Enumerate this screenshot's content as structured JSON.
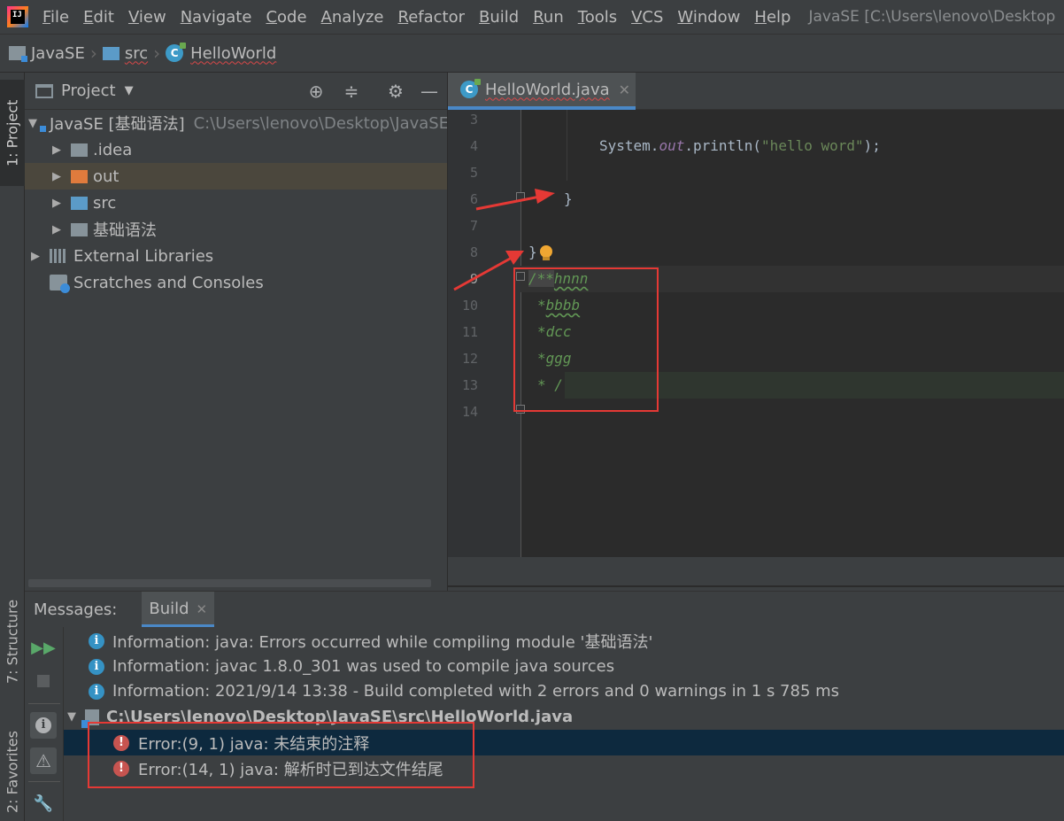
{
  "app": {
    "logo_text": "IJ",
    "window_title": "JavaSE [C:\\Users\\lenovo\\Desktop"
  },
  "menu": [
    "File",
    "Edit",
    "View",
    "Navigate",
    "Code",
    "Analyze",
    "Refactor",
    "Build",
    "Run",
    "Tools",
    "VCS",
    "Window",
    "Help"
  ],
  "breadcrumb": {
    "project": "JavaSE",
    "folder": "src",
    "file": "HelloWorld"
  },
  "left_strip": {
    "project_tab": "1: Project",
    "structure_tab": "7: Structure",
    "favorites_tab": "2: Favorites"
  },
  "project_panel": {
    "title": "Project",
    "tree": [
      {
        "label": "JavaSE [基础语法]",
        "path": "C:\\Users\\lenovo\\Desktop\\JavaSE",
        "expanded": true
      },
      {
        "label": ".idea"
      },
      {
        "label": "out",
        "selected": true
      },
      {
        "label": "src"
      },
      {
        "label": "基础语法"
      },
      {
        "label": "External Libraries"
      },
      {
        "label": "Scratches and Consoles"
      }
    ]
  },
  "editor": {
    "tab_label": "HelloWorld.java",
    "line_numbers": [
      "3",
      "4",
      "5",
      "6",
      "7",
      "8",
      "9",
      "10",
      "11",
      "12",
      "13",
      "14"
    ],
    "lines": {
      "l4_a": "System.",
      "l4_b": "out",
      "l4_c": ".println(",
      "l4_d": "\"hello word\"",
      "l4_e": ");",
      "l6": "}",
      "l8": "}",
      "l9_a": "/**",
      "l9_b": "hnnn",
      "l10_a": "*",
      "l10_b": "bbbb",
      "l11": "*dcc",
      "l12": "*ggg",
      "l13": "* /"
    }
  },
  "build": {
    "messages_label": "Messages:",
    "tab_label": "Build",
    "info": [
      "Information: java: Errors occurred while compiling module '基础语法'",
      "Information: javac 1.8.0_301 was used to compile java sources",
      "Information: 2021/9/14 13:38 - Build completed with 2 errors and 0 warnings in 1 s 785 ms"
    ],
    "file_path": "C:\\Users\\lenovo\\Desktop\\JavaSE\\src\\HelloWorld.java",
    "errors": [
      "Error:(9, 1)  java: 未结束的注释",
      "Error:(14, 1)  java: 解析时已到达文件结尾"
    ]
  },
  "colors": {
    "accent": "#4a88c7",
    "annotation_red": "#e53935",
    "error": "#c75450",
    "info": "#3592c4"
  }
}
